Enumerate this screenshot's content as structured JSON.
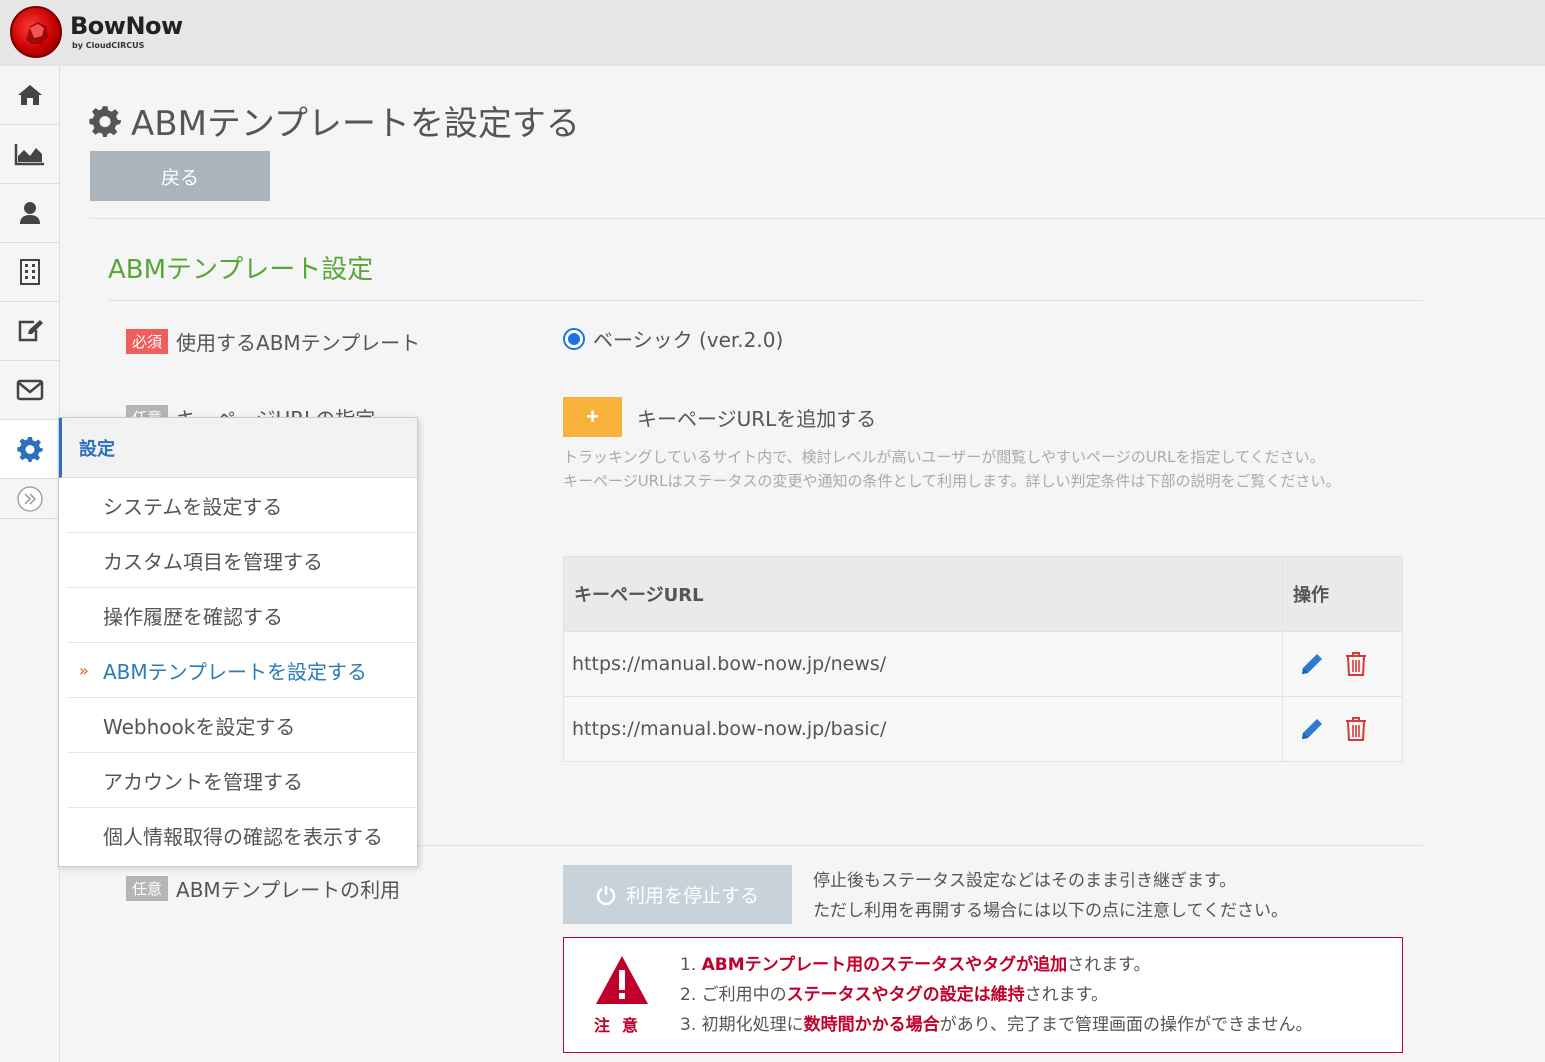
{
  "brand": {
    "name": "BowNow",
    "sub": "by CloudCIRCUS"
  },
  "sidebar": {
    "items": [
      {
        "icon": "home-icon"
      },
      {
        "icon": "chart-area-icon"
      },
      {
        "icon": "user-icon"
      },
      {
        "icon": "building-icon"
      },
      {
        "icon": "edit-icon"
      },
      {
        "icon": "mail-icon"
      },
      {
        "icon": "gear-icon",
        "active": true
      }
    ],
    "expand_icon": "double-chevron-right-icon"
  },
  "page": {
    "title": "ABMテンプレートを設定する",
    "back_label": "戻る",
    "section_title": "ABMテンプレート設定"
  },
  "form": {
    "template": {
      "badge": "必須",
      "label": "使用するABMテンプレート",
      "option": "ベーシック (ver.2.0)"
    },
    "keypage": {
      "badge": "任意",
      "label": "キーページURLの指定",
      "add_label": "キーページURLを追加する",
      "help_line1": "トラッキングしているサイト内で、検討レベルが高いユーザーが閲覧しやすいページのURLを指定してください。",
      "help_line2": "キーページURLはステータスの変更や通知の条件として利用します。詳しい判定条件は下部の説明をご覧ください。",
      "table": {
        "col_url": "キーページURL",
        "col_ops": "操作",
        "rows": [
          {
            "url": "https://manual.bow-now.jp/news/"
          },
          {
            "url": "https://manual.bow-now.jp/basic/"
          }
        ]
      }
    },
    "usage": {
      "badge": "任意",
      "label": "ABMテンプレートの利用",
      "stop_label": "利用を停止する",
      "note_line1": "停止後もステータス設定などはそのまま引き継ぎます。",
      "note_line2": "ただし利用を再開する場合には以下の点に注意してください。",
      "warning": {
        "label": "注意",
        "item1_num": "1.",
        "item1_em": "ABMテンプレート用のステータスやタグが追加",
        "item1_rest": "されます。",
        "item2_num": "2.",
        "item2_pre": "ご利用中の",
        "item2_em": "ステータスやタグの設定は維持",
        "item2_rest": "されます。",
        "item3_num": "3.",
        "item3_pre": "初期化処理に",
        "item3_em": "数時間かかる場合",
        "item3_rest": "があり、完了まで管理画面の操作ができません。"
      }
    }
  },
  "settings_menu": {
    "header": "設定",
    "items": [
      {
        "label": "システムを設定する"
      },
      {
        "label": "カスタム項目を管理する"
      },
      {
        "label": "操作履歴を確認する"
      },
      {
        "label": "ABMテンプレートを設定する",
        "active": true
      },
      {
        "label": "Webhookを設定する"
      },
      {
        "label": "アカウントを管理する"
      },
      {
        "label": "個人情報取得の確認を表示する"
      }
    ],
    "active_marker": "»"
  },
  "colors": {
    "accent_blue": "#2c6fba",
    "section_green": "#5aa53a",
    "required_red": "#f05d5d",
    "warning_red": "#c0002b",
    "add_orange": "#f7b23b"
  }
}
